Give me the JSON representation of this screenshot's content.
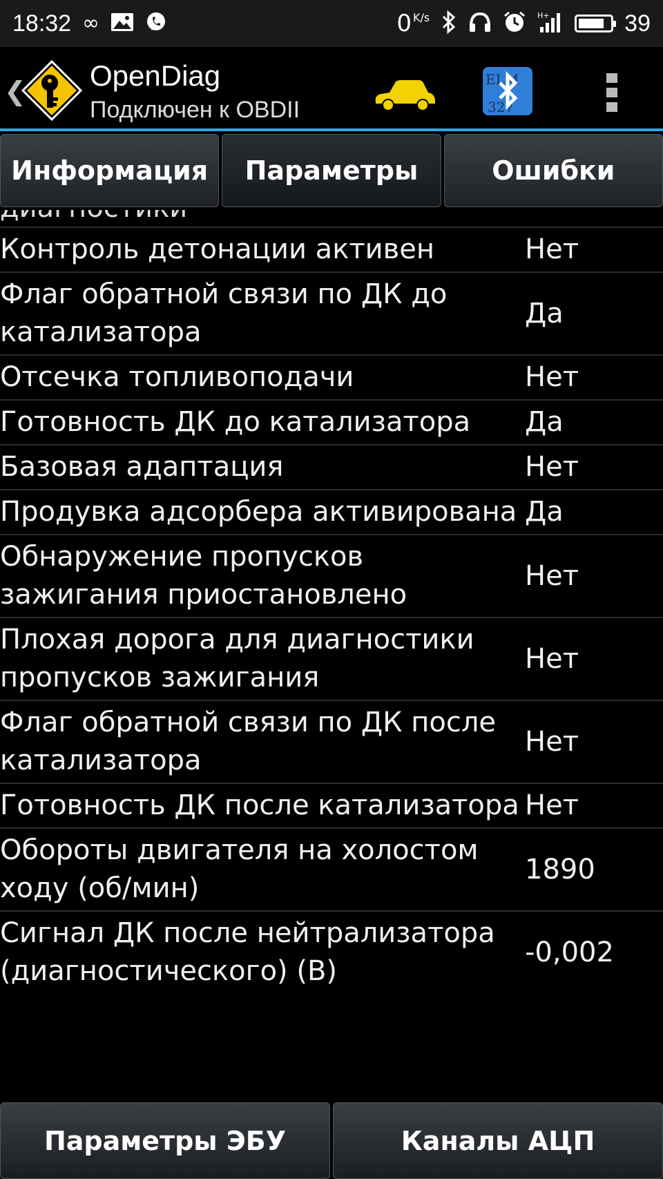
{
  "status_bar": {
    "time": "18:32",
    "speed": "0",
    "speed_unit": "K/s",
    "battery_level": 0.82,
    "battery_number": "39",
    "icons": [
      "infinity-icon",
      "image-icon",
      "viber-icon",
      "bluetooth-icon",
      "headphones-icon",
      "alarm-icon",
      "signal-icon",
      "battery-icon"
    ]
  },
  "app_bar": {
    "title": "OpenDiag",
    "subtitle": "Подключен к OBDII",
    "car_color": "#f2d200",
    "accent": "#33a8e0"
  },
  "tabs": [
    {
      "label": "Информация"
    },
    {
      "label": "Параметры"
    },
    {
      "label": "Ошибки"
    }
  ],
  "list": {
    "partial_top_label": "диагностики",
    "rows": [
      {
        "label": "Контроль детонации активен",
        "value": "Нет"
      },
      {
        "label": "Флаг обратной связи по ДК до катализатора",
        "value": "Да"
      },
      {
        "label": "Отсечка топливоподачи",
        "value": "Нет"
      },
      {
        "label": "Готовность ДК до катализатора",
        "value": "Да"
      },
      {
        "label": "Базовая адаптация",
        "value": "Нет"
      },
      {
        "label": "Продувка адсорбера активирована",
        "value": "Да"
      },
      {
        "label": "Обнаружение пропусков зажигания приостановлено",
        "value": "Нет"
      },
      {
        "label": "Плохая дорога для диагностики пропусков зажигания",
        "value": "Нет"
      },
      {
        "label": "Флаг обратной связи по ДК после катализатора",
        "value": "Нет"
      },
      {
        "label": "Готовность ДК после катализатора",
        "value": "Нет"
      },
      {
        "label": "Обороты двигателя на холостом ходу (об/мин)",
        "value": "1890"
      },
      {
        "label": "Сигнал ДК после нейтрализатора (диагностического) (В)",
        "value": "-0,002"
      }
    ]
  },
  "bottom_buttons": [
    {
      "label": "Параметры ЭБУ"
    },
    {
      "label": "Каналы АЦП"
    }
  ]
}
